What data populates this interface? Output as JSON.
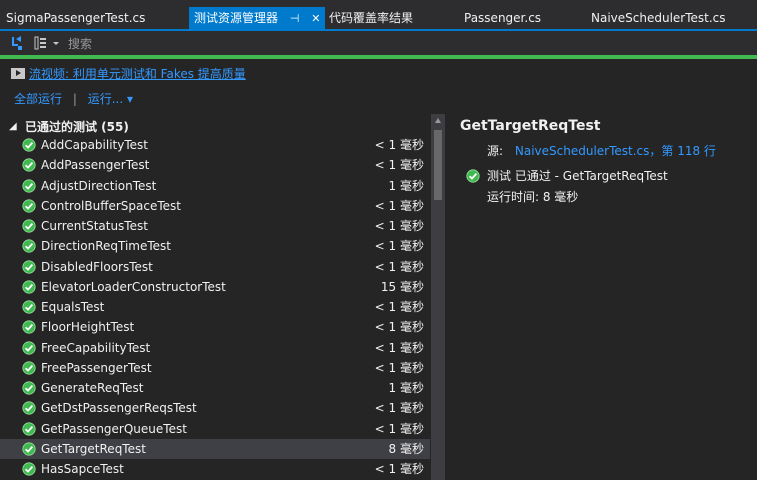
{
  "tabs": [
    {
      "label": "SigmaPassengerTest.cs",
      "active": false
    },
    {
      "label": "测试资源管理器",
      "active": true,
      "pin": "⊣",
      "close": "✕"
    },
    {
      "label": "代码覆盖率结果",
      "active": false
    },
    {
      "label": "Passenger.cs",
      "active": false
    },
    {
      "label": "NaiveSchedulerTest.cs",
      "active": false
    }
  ],
  "toolbar": {
    "search_placeholder": "搜索",
    "icons": [
      "run-icon",
      "group-by-icon"
    ]
  },
  "promo_link": "流视频: 利用单元测试和 Fakes 提高质量",
  "actions": {
    "run_all": "全部运行",
    "separator": "|",
    "run": "运行...",
    "run_dropdown": "▾"
  },
  "tree": {
    "group": {
      "arrow": "◢",
      "label": "已通过的测试 (55)"
    },
    "rows": [
      {
        "name": "AddCapabilityTest",
        "duration": "< 1 毫秒"
      },
      {
        "name": "AddPassengerTest",
        "duration": "< 1 毫秒"
      },
      {
        "name": "AdjustDirectionTest",
        "duration": "1 毫秒"
      },
      {
        "name": "ControlBufferSpaceTest",
        "duration": "< 1 毫秒"
      },
      {
        "name": "CurrentStatusTest",
        "duration": "< 1 毫秒"
      },
      {
        "name": "DirectionReqTimeTest",
        "duration": "< 1 毫秒"
      },
      {
        "name": "DisabledFloorsTest",
        "duration": "< 1 毫秒"
      },
      {
        "name": "ElevatorLoaderConstructorTest",
        "duration": "15 毫秒"
      },
      {
        "name": "EqualsTest",
        "duration": "< 1 毫秒"
      },
      {
        "name": "FloorHeightTest",
        "duration": "< 1 毫秒"
      },
      {
        "name": "FreeCapabilityTest",
        "duration": "< 1 毫秒"
      },
      {
        "name": "FreePassengerTest",
        "duration": "< 1 毫秒"
      },
      {
        "name": "GenerateReqTest",
        "duration": "1 毫秒"
      },
      {
        "name": "GetDstPassengerReqsTest",
        "duration": "< 1 毫秒"
      },
      {
        "name": "GetPassengerQueueTest",
        "duration": "< 1 毫秒"
      },
      {
        "name": "GetTargetReqTest",
        "duration": "8 毫秒",
        "selected": true
      },
      {
        "name": "HasSapceTest",
        "duration": "< 1 毫秒"
      }
    ]
  },
  "details": {
    "title": "GetTargetReqTest",
    "source_label": "源:",
    "source_link": "NaiveSchedulerTest.cs，第 118 行",
    "status": "测试 已通过 - GetTargetReqTest",
    "runtime": "运行时间: 8 毫秒"
  },
  "colors": {
    "accent": "#007acc",
    "pass": "#3fb950",
    "link": "#3399ff",
    "background": "#252526"
  }
}
